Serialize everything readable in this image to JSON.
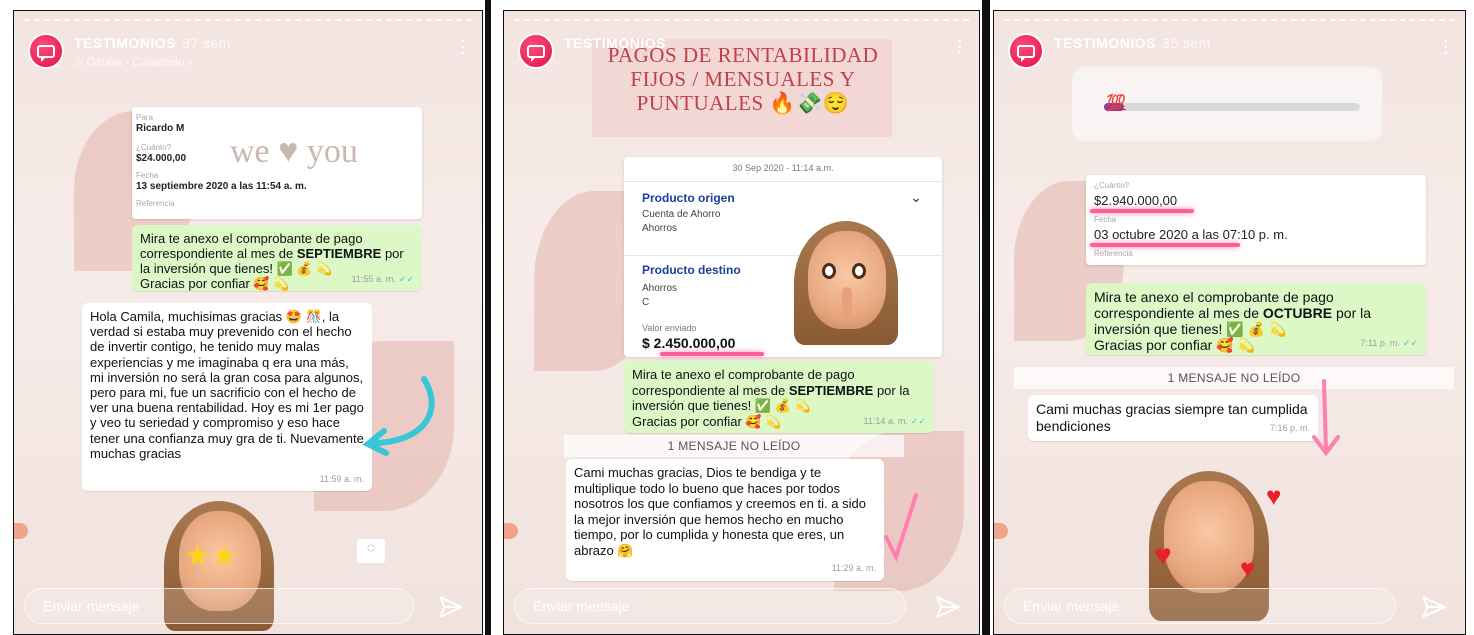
{
  "stories": [
    {
      "account": "TESTIMONIOS",
      "age": "37 sem",
      "music": "Ozuna · Caramelo",
      "reply_placeholder": "Enviar mensaje",
      "receipt": {
        "para_label": "Para",
        "para_value": "Ricardo M",
        "cuanto_label": "¿Cuánto?",
        "cuanto_value": "$24.000,00",
        "fecha_label": "Fecha",
        "fecha_value": "13 septiembre 2020 a las 11:54 a. m.",
        "referencia_label": "Referencia",
        "sticker_text": "we ♥ you"
      },
      "sent_message": {
        "text_before": "Mira te anexo el comprobante de pago correspondiente al mes de ",
        "month": "SEPTIEMBRE",
        "text_after": " por la inversión que tienes! ✅ 💰 💫",
        "line_thanks": "Gracias por confiar 🥰 💫",
        "time": "11:55 a. m."
      },
      "reply_message": {
        "text": "Hola Camila, muchisimas gracias 🤩 🎊, la verdad si estaba muy prevenido con el hecho de invertir contigo, he tenido muy malas experiencias y me imaginaba q era una más, mi inversión no será la gran cosa para algunos, pero para mi, fue un sacrificio con el hecho de ver una buena rentabilidad. Hoy es mi 1er pago y veo tu seriedad y compromiso y eso hace tener una confianza muy gra de ti. Nuevamente muchas gracias",
        "time": "11:59 a. m."
      }
    },
    {
      "account": "TESTIMONIOS",
      "title": "PAGOS DE RENTABILIDAD FIJOS / MENSUALES Y PUNTUALES 🔥💸😌",
      "reply_placeholder": "Enviar mensaje",
      "receipt": {
        "date": "30 Sep 2020 - 11:14 a.m.",
        "origen_label": "Producto origen",
        "origen_line1": "Cuenta de Ahorro",
        "origen_line2": "Ahorros",
        "destino_label": "Producto destino",
        "destino_line1": "Ahorros",
        "destino_line2": "C",
        "valor_label": "Valor enviado",
        "valor_value": "$ 2.450.000,00"
      },
      "sent_message": {
        "text_before": "Mira te anexo el comprobante de pago correspondiente al mes de ",
        "month": "SEPTIEMBRE",
        "text_after": " por la inversión que tienes! ✅ 💰 💫",
        "line_thanks": "Gracias por confiar 🥰 💫",
        "time": "11:14 a. m."
      },
      "unread": "1 MENSAJE NO LEÍDO",
      "reply_message": {
        "text": "Cami muchas gracias, Dios te bendiga y te multiplique todo lo bueno que haces por todos nosotros los que confiamos y creemos en ti.  a sido la mejor inversión que hemos hecho en mucho tiempo, por lo cumplida y honesta que eres, un abrazo 🤗",
        "time": "11:29 a. m."
      }
    },
    {
      "account": "TESTIMONIOS",
      "age": "35 sem",
      "reply_placeholder": "Enviar mensaje",
      "poll_emoji": "💯",
      "poll_fill": 0.08,
      "receipt": {
        "cuanto_label": "¿Cuánto?",
        "cuanto_value": "$2.940.000,00",
        "fecha_label": "Fecha",
        "fecha_value": "03 octubre 2020 a las 07:10 p. m.",
        "referencia_label": "Referencia"
      },
      "sent_message": {
        "text_before": "Mira te anexo el comprobante de pago correspondiente al mes de ",
        "month": "OCTUBRE",
        "text_after": " por la inversión que tienes! ✅ 💰 💫",
        "line_thanks": "Gracias por confiar 🥰 💫",
        "time": "7:11 p. m."
      },
      "unread": "1 MENSAJE NO LEÍDO",
      "reply_message": {
        "text": "Cami muchas gracias siempre tan cumplida bendiciones",
        "time": "7:16 p. m."
      }
    }
  ],
  "colors": {
    "accent_pink": "#ff5c9a",
    "whatsapp_green": "#dcf8c6",
    "avatar_red": "#e0104a"
  }
}
